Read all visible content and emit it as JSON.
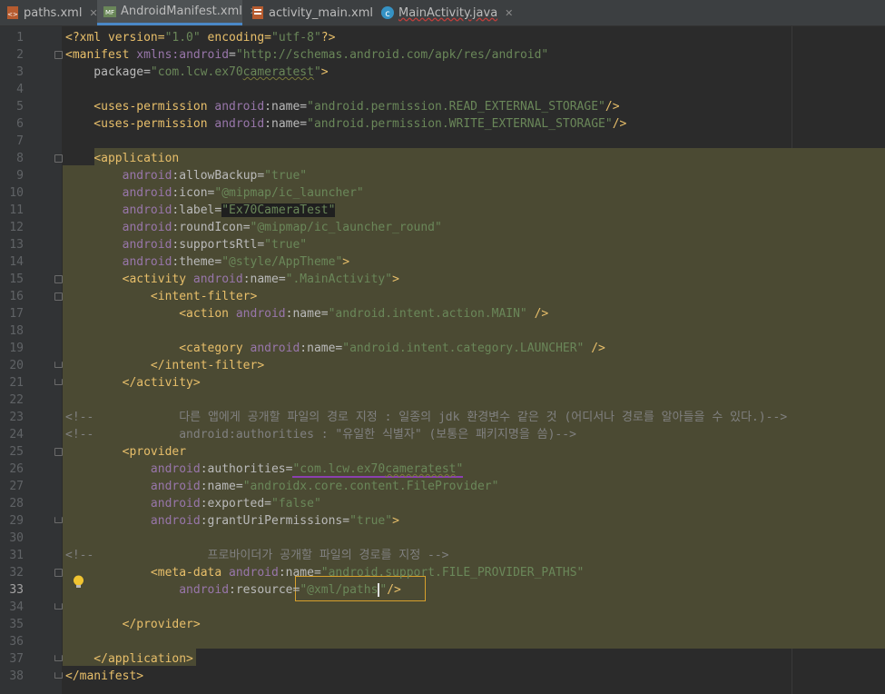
{
  "tabs": [
    {
      "label": "paths.xml",
      "icon": "xml-file-icon",
      "active": false
    },
    {
      "label": "AndroidManifest.xml",
      "icon": "manifest-file-icon",
      "active": true
    },
    {
      "label": "activity_main.xml",
      "icon": "layout-file-icon",
      "active": false
    },
    {
      "label": "MainActivity.java",
      "icon": "java-class-icon",
      "active": false,
      "error": true
    }
  ],
  "close_glyph": "✕",
  "line_numbers": [
    "1",
    "2",
    "3",
    "4",
    "5",
    "6",
    "7",
    "8",
    "9",
    "10",
    "11",
    "12",
    "13",
    "14",
    "15",
    "16",
    "17",
    "18",
    "19",
    "20",
    "21",
    "22",
    "23",
    "24",
    "25",
    "26",
    "27",
    "28",
    "29",
    "30",
    "31",
    "32",
    "33",
    "34",
    "35",
    "36",
    "37",
    "38"
  ],
  "current_line": "33",
  "code": {
    "l1": {
      "a": "<?xml version=",
      "b": "\"1.0\"",
      "c": " encoding=",
      "d": "\"utf-8\"",
      "e": "?>"
    },
    "l2": {
      "a": "<manifest ",
      "b": "xmlns:",
      "c": "android",
      "d": "=",
      "e": "\"http://schemas.android.com/apk/res/android\""
    },
    "l3": {
      "a": "    package=",
      "b": "\"com.lcw.ex70",
      "c": "cameratest",
      "d": "\"",
      "e": ">"
    },
    "l5": {
      "a": "    <uses-permission ",
      "b": "android",
      "c": ":name=",
      "d": "\"android.permission.READ_EXTERNAL_STORAGE\"",
      "e": "/>"
    },
    "l6": {
      "a": "    <uses-permission ",
      "b": "android",
      "c": ":name=",
      "d": "\"android.permission.WRITE_EXTERNAL_STORAGE\"",
      "e": "/>"
    },
    "l8": {
      "a": "    ",
      "b": "<application"
    },
    "l9": {
      "a": "        ",
      "b": "android",
      "c": ":allowBackup=",
      "d": "\"true\""
    },
    "l10": {
      "a": "        ",
      "b": "android",
      "c": ":icon=",
      "d": "\"@mipmap/ic_launcher\""
    },
    "l11": {
      "a": "        ",
      "b": "android",
      "c": ":label=",
      "d": "\"Ex70CameraTest\""
    },
    "l12": {
      "a": "        ",
      "b": "android",
      "c": ":roundIcon=",
      "d": "\"@mipmap/ic_launcher_round\""
    },
    "l13": {
      "a": "        ",
      "b": "android",
      "c": ":supportsRtl=",
      "d": "\"true\""
    },
    "l14": {
      "a": "        ",
      "b": "android",
      "c": ":theme=",
      "d": "\"@style/AppTheme\"",
      "e": ">"
    },
    "l15": {
      "a": "        <activity ",
      "b": "android",
      "c": ":name=",
      "d": "\".MainActivity\"",
      "e": ">"
    },
    "l16": {
      "a": "            <intent-filter>"
    },
    "l17": {
      "a": "                <action ",
      "b": "android",
      "c": ":name=",
      "d": "\"android.intent.action.MAIN\"",
      "e": " />"
    },
    "l19": {
      "a": "                <category ",
      "b": "android",
      "c": ":name=",
      "d": "\"android.intent.category.LAUNCHER\"",
      "e": " />"
    },
    "l20": {
      "a": "            </intent-filter>"
    },
    "l21": {
      "a": "        </activity>"
    },
    "l23": {
      "a": "<!--            다른 앱에게 공개할 파일의 경로 지정 : 일종의 jdk 환경변수 같은 것 (어디서나 경로를 알아들을 수 있다.)-->"
    },
    "l24": {
      "a": "<!--            android:authorities : \"유일한 식별자\" (보통은 패키지명을 씀)-->"
    },
    "l25": {
      "a": "        <provider"
    },
    "l26": {
      "a": "            ",
      "b": "android",
      "c": ":authorities=",
      "d": "\"com.lcw.ex70",
      "e": "cameratest",
      "f": "\""
    },
    "l27": {
      "a": "            ",
      "b": "android",
      "c": ":name=",
      "d": "\"androidx.core.content.FileProvider\""
    },
    "l28": {
      "a": "            ",
      "b": "android",
      "c": ":exported=",
      "d": "\"false\""
    },
    "l29": {
      "a": "            ",
      "b": "android",
      "c": ":grantUriPermissions=",
      "d": "\"true\"",
      "e": ">"
    },
    "l31": {
      "a": "<!--                프로바이더가 공개할 파일의 경로를 지정 -->"
    },
    "l32": {
      "a": "            <meta-data ",
      "b": "android",
      "c": ":name=",
      "d": "\"android.support.FILE_PROVIDER_PATHS\""
    },
    "l33": {
      "a": "                ",
      "b": "android",
      "c": ":resource=",
      "d": "\"@xml/paths",
      "e": "\"",
      "f": "/>"
    },
    "l35": {
      "a": "        </provider>"
    },
    "l37": {
      "a": "    </application>"
    },
    "l38": {
      "a": "</manifest>"
    }
  },
  "colors": {
    "background": "#2b2b2b",
    "gutter": "#313335",
    "tag": "#e8bf6a",
    "namespace": "#9876aa",
    "attribute": "#bababa",
    "string": "#6a8759",
    "comment": "#808080",
    "selection_highlight": "#4b4a33"
  }
}
